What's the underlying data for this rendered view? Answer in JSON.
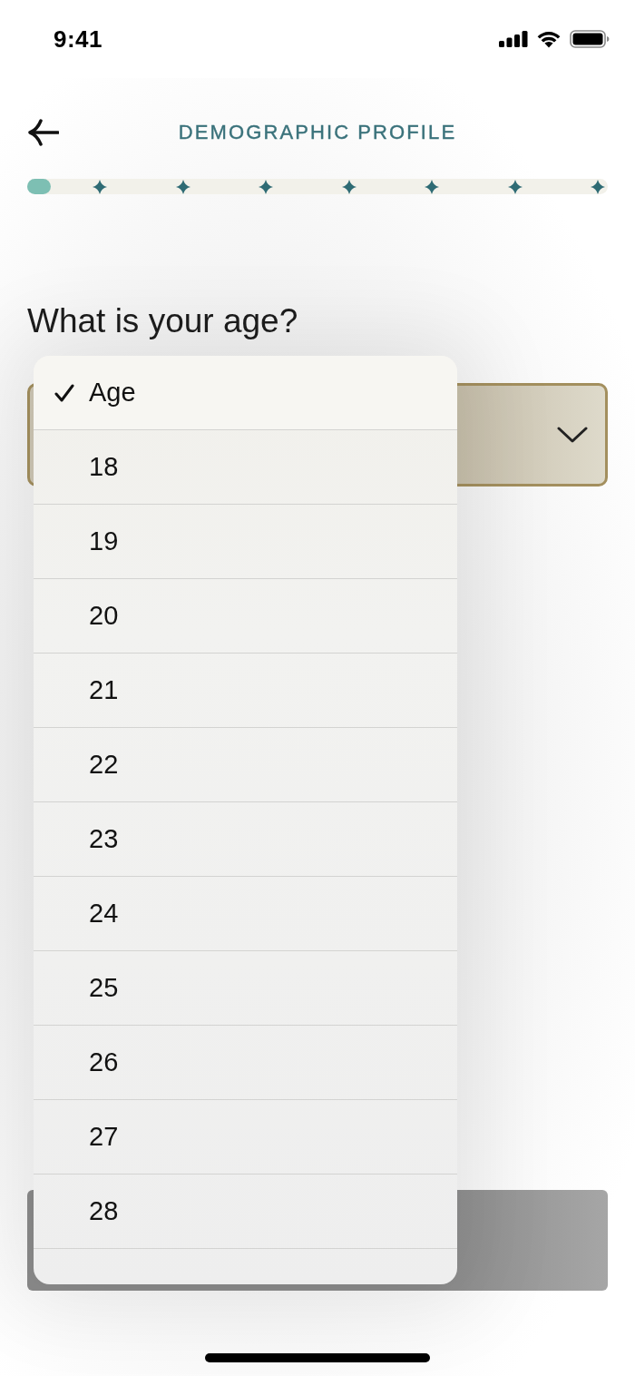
{
  "status_bar": {
    "time": "9:41"
  },
  "header": {
    "title": "DEMOGRAPHIC PROFILE"
  },
  "progress": {
    "level": 0.04,
    "checkpoints": [
      {
        "reached": false
      },
      {
        "reached": false
      },
      {
        "reached": false
      },
      {
        "reached": false
      },
      {
        "reached": false
      },
      {
        "reached": false
      },
      {
        "reached": false
      }
    ]
  },
  "question": {
    "text": "What is your age?"
  },
  "age_select": {
    "open": true
  },
  "dropdown": {
    "options": [
      {
        "label": "Age",
        "selected": true
      },
      {
        "label": "18",
        "selected": false
      },
      {
        "label": "19",
        "selected": false
      },
      {
        "label": "20",
        "selected": false
      },
      {
        "label": "21",
        "selected": false
      },
      {
        "label": "22",
        "selected": false
      },
      {
        "label": "23",
        "selected": false
      },
      {
        "label": "24",
        "selected": false
      },
      {
        "label": "25",
        "selected": false
      },
      {
        "label": "26",
        "selected": false
      },
      {
        "label": "27",
        "selected": false
      },
      {
        "label": "28",
        "selected": false
      }
    ]
  },
  "action_button": {
    "disabled": true
  }
}
